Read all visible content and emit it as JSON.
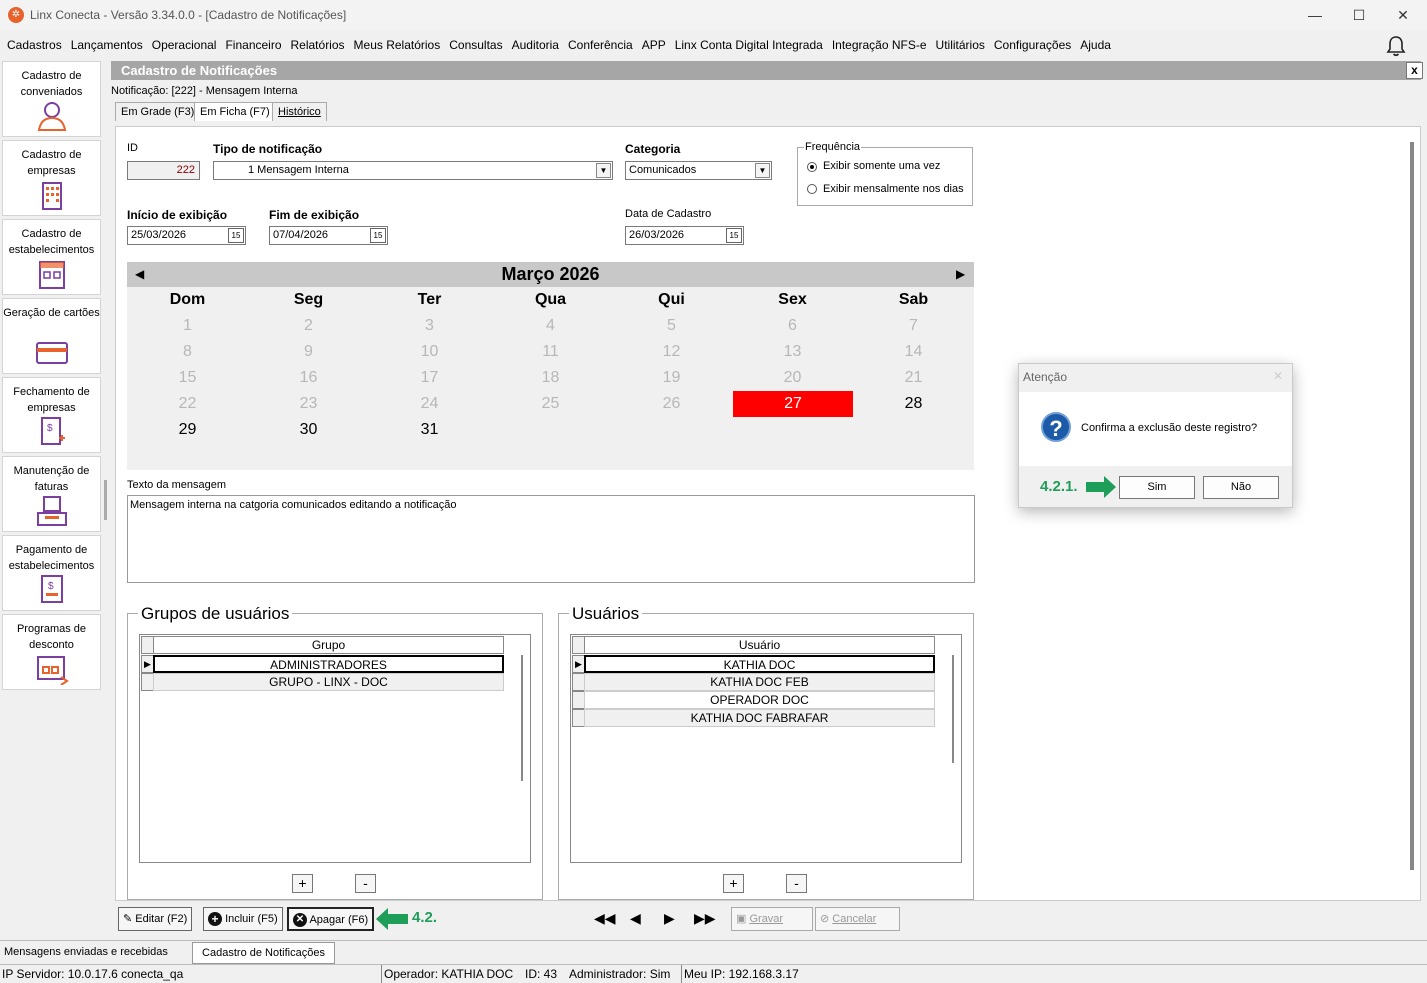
{
  "window": {
    "title": "Linx Conecta - Versão 3.34.0.0 - [Cadastro de Notificações]",
    "minimize": "—",
    "maximize": "☐",
    "close": "✕"
  },
  "menu": [
    "Cadastros",
    "Lançamentos",
    "Operacional",
    "Financeiro",
    "Relatórios",
    "Meus Relatórios",
    "Consultas",
    "Auditoria",
    "Conferência",
    "APP",
    "Linx Conta Digital Integrada",
    "Integração NFS-e",
    "Utilitários",
    "Configurações",
    "Ajuda"
  ],
  "sidebar": [
    {
      "label": "Cadastro de conveniados",
      "icon": "user-icon"
    },
    {
      "label": "Cadastro de empresas",
      "icon": "building-icon"
    },
    {
      "label": "Cadastro de estabelecimentos",
      "icon": "store-icon"
    },
    {
      "label": "Geração de cartões",
      "icon": "card-icon"
    },
    {
      "label": "Fechamento de empresas",
      "icon": "invoice-icon"
    },
    {
      "label": "Manutenção de faturas",
      "icon": "tray-icon"
    },
    {
      "label": "Pagamento de estabelecimentos",
      "icon": "payment-icon"
    },
    {
      "label": "Programas de desconto",
      "icon": "discount-icon"
    }
  ],
  "form": {
    "header": "Cadastro de Notificações",
    "close": "x",
    "notification_label": "Notificação: [222] - Mensagem Interna",
    "tabs": [
      "Em Grade (F3)",
      "Em Ficha (F7)",
      "Histórico"
    ],
    "id_label": "ID",
    "id_value": "222",
    "tipo_label": "Tipo de notificação",
    "tipo_value": "1  Mensagem Interna",
    "categoria_label": "Categoria",
    "categoria_value": "Comunicados",
    "freq_title": "Frequência",
    "freq_options": [
      "Exibir somente uma vez",
      "Exibir mensalmente nos dias"
    ],
    "freq_selected": 0,
    "inicio_label": "Início de exibição",
    "inicio_value": "25/03/2026",
    "fim_label": "Fim de exibição",
    "fim_value": "07/04/2026",
    "cadastro_label": "Data de Cadastro",
    "cadastro_value": "26/03/2026",
    "texto_label": "Texto da mensagem",
    "texto_value": "Mensagem interna na catgoria comunicados editando a notificação"
  },
  "calendar": {
    "month": "Março 2026",
    "weekdays": [
      "Dom",
      "Seg",
      "Ter",
      "Qua",
      "Qui",
      "Sex",
      "Sab"
    ],
    "days": [
      [
        "1",
        "2",
        "3",
        "4",
        "5",
        "6",
        "7"
      ],
      [
        "8",
        "9",
        "10",
        "11",
        "12",
        "13",
        "14"
      ],
      [
        "15",
        "16",
        "17",
        "18",
        "19",
        "20",
        "21"
      ],
      [
        "22",
        "23",
        "24",
        "25",
        "26",
        "27",
        "28"
      ],
      [
        "29",
        "30",
        "31",
        "",
        "",
        "",
        ""
      ]
    ],
    "selected_day": "27",
    "muted_upto": 26
  },
  "groups": {
    "title": "Grupos de usuários",
    "column": "Grupo",
    "rows": [
      "ADMINISTRADORES",
      "GRUPO - LINX - DOC"
    ],
    "add": "+",
    "remove": "-"
  },
  "users": {
    "title": "Usuários",
    "column": "Usuário",
    "rows": [
      "KATHIA DOC",
      "KATHIA DOC FEB",
      "OPERADOR DOC",
      "KATHIA DOC FABRAFAR"
    ],
    "add": "+",
    "remove": "-"
  },
  "toolbar": {
    "edit": "Editar (F2)",
    "include": "Incluir (F5)",
    "delete": "Apagar (F6)",
    "save": "Gravar",
    "cancel": "Cancelar",
    "annotation": "4.2."
  },
  "status": {
    "tab1": "Mensagens enviadas e recebidas",
    "tab2": "Cadastro de Notificações",
    "server": "IP Servidor: 10.0.17.6 conecta_qa",
    "operator": "Operador: KATHIA DOC",
    "id": "ID: 43",
    "admin": "Administrador: Sim",
    "ip": "Meu IP: 192.168.3.17"
  },
  "dialog": {
    "title": "Atenção",
    "close": "✕",
    "message": "Confirma a exclusão deste registro?",
    "yes": "Sim",
    "no": "Não",
    "annotation": "4.2.1."
  },
  "colors": {
    "selected_day": "#ff0000",
    "annotation": "#1f9e5a",
    "header": "#a6a6a6",
    "accent_icon": "#7b3fa0"
  }
}
